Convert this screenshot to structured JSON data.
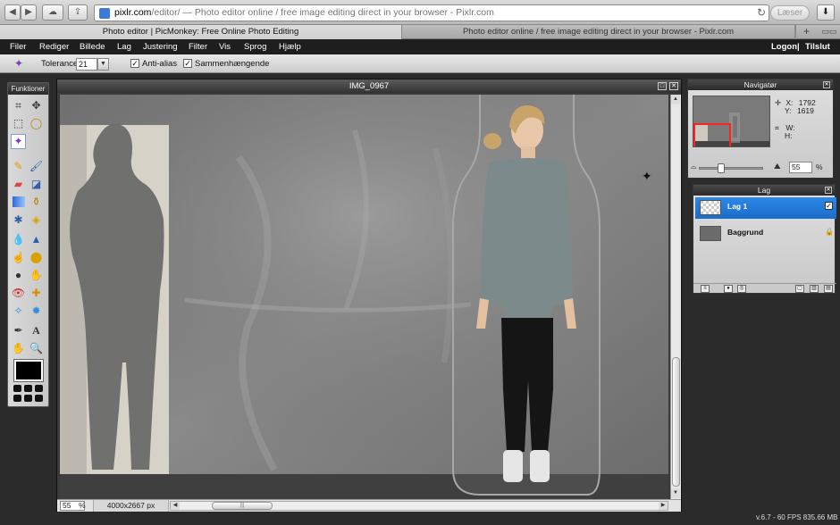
{
  "browser": {
    "url_host": "pixlr.com",
    "url_rest": "/editor/ — Photo editor online / free image editing direct in your browser - Pixlr.com",
    "reader_label": "Læser",
    "tabs": [
      {
        "label": "Photo editor | PicMonkey: Free Online Photo Editing",
        "active": true
      },
      {
        "label": "Photo editor online / free image editing direct in your browser - Pixlr.com",
        "active": false
      }
    ]
  },
  "menu": {
    "items": [
      "Filer",
      "Rediger",
      "Billede",
      "Lag",
      "Justering",
      "Filter",
      "Vis",
      "Sprog",
      "Hjælp"
    ],
    "logon": "Logon",
    "separator": "|",
    "signup": "Tilslut"
  },
  "options": {
    "tolerance_label": "Tolerance:",
    "tolerance_value": "21",
    "antialias_label": "Anti-alias",
    "contiguous_label": "Sammenhængende"
  },
  "tools_panel": {
    "title": "Funktioner",
    "foreground_color": "#000000"
  },
  "document": {
    "title": "IMG_0967",
    "zoom": "55",
    "zoom_unit": "%",
    "dimensions": "4000x2667 px"
  },
  "navigator": {
    "title": "Navigatør",
    "x_label": "X:",
    "x_value": "1792",
    "y_label": "Y:",
    "y_value": "1619",
    "w_label": "W:",
    "h_label": "H:",
    "zoom": "55",
    "zoom_unit": "%"
  },
  "layers": {
    "title": "Lag",
    "items": [
      {
        "name": "Lag 1",
        "active": true
      },
      {
        "name": "Baggrund",
        "active": false
      }
    ]
  },
  "status": {
    "fps": "v.6.7 - 60 FPS 835.66 MB"
  },
  "colors": {
    "accent": "#1a6cc9",
    "menu_bg": "#1e1e1e"
  }
}
